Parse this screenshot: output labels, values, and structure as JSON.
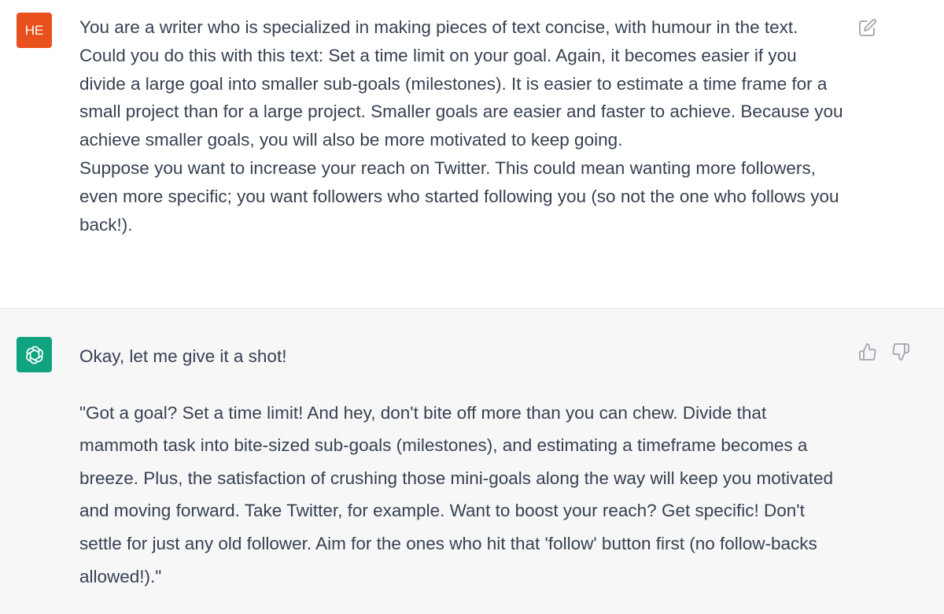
{
  "conversation": {
    "user_message": {
      "avatar_initials": "HE",
      "avatar_color": "#e8501d",
      "paragraphs": [
        "You are a writer who is specialized in making pieces of text concise, with humour in the text. Could you do this with this text: Set a time limit on your goal. Again, it becomes easier if you divide a large goal into smaller sub-goals (milestones). It is easier to estimate a time frame for a small project than for a large project. Smaller goals are easier and faster to achieve. Because you achieve smaller goals, you will also be more motivated to keep going.",
        "Suppose you want to increase your reach on Twitter. This could mean wanting more followers, even more specific; you want followers who started following you (so not the one who follows you back!)."
      ],
      "edit_icon": "edit-pencil-icon"
    },
    "assistant_message": {
      "avatar_icon": "openai-logo-icon",
      "avatar_color": "#10a37f",
      "lead": "Okay, let me give it a shot!",
      "body": "\"Got a goal? Set a time limit! And hey, don't bite off more than you can chew. Divide that mammoth task into bite-sized sub-goals (milestones), and estimating a timeframe becomes a breeze. Plus, the satisfaction of crushing those mini-goals along the way will keep you motivated and moving forward. Take Twitter, for example. Want to boost your reach? Get specific! Don't settle for just any old follower. Aim for the ones who hit that 'follow' button first (no follow-backs allowed!).\"",
      "thumbs_up_icon": "thumbs-up-icon",
      "thumbs_down_icon": "thumbs-down-icon"
    }
  },
  "colors": {
    "text": "#374151",
    "icon": "#a3a3ad",
    "assistant_bg": "#f7f7f8"
  }
}
